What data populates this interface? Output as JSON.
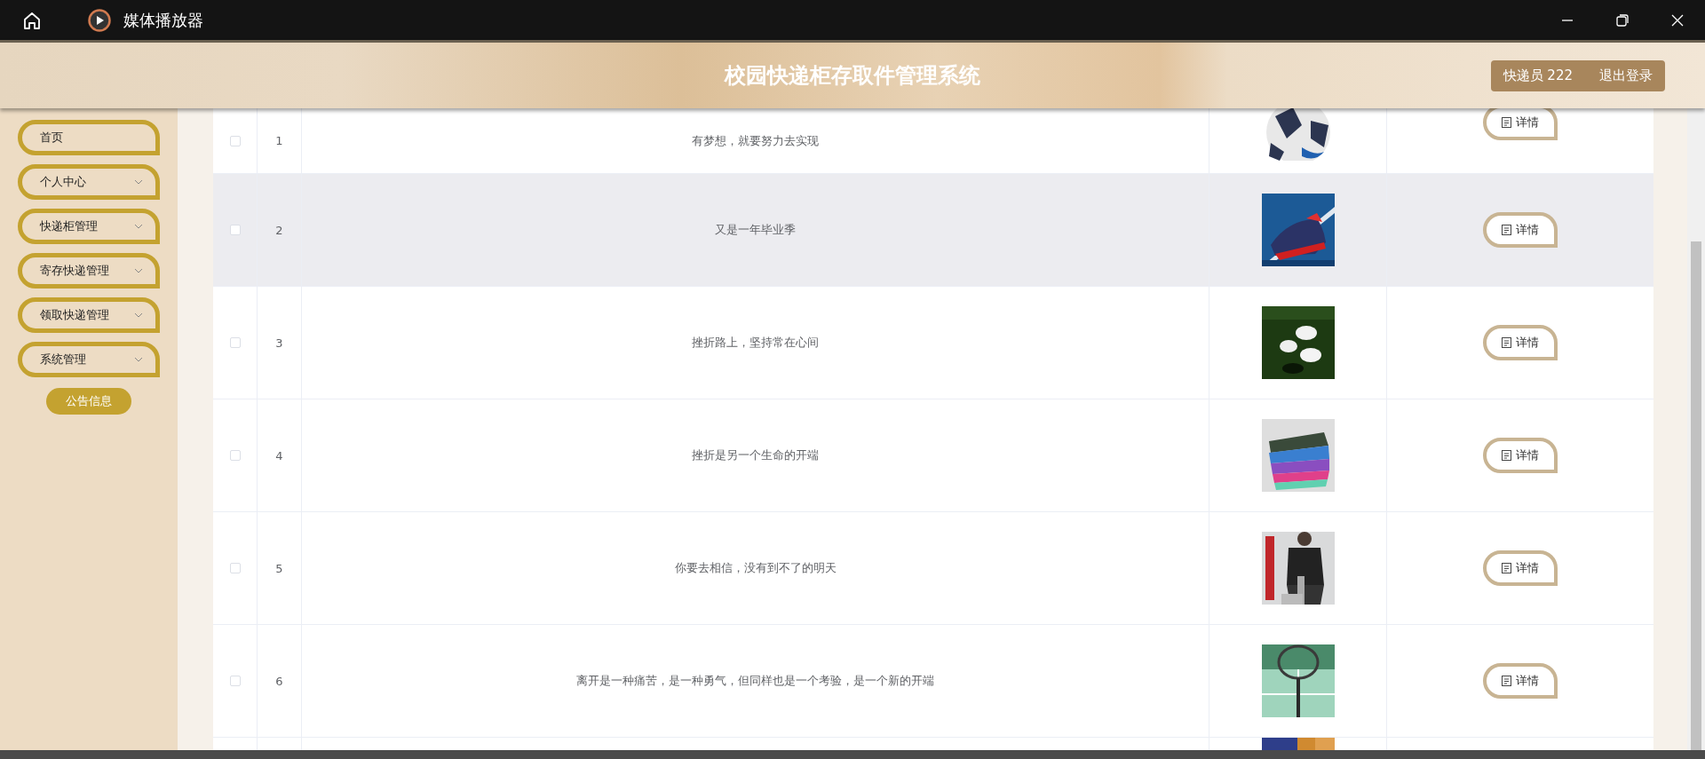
{
  "titlebar": {
    "app_name": "媒体播放器"
  },
  "header": {
    "title": "校园快递柜存取件管理系统",
    "user": "快递员 222",
    "logout": "退出登录"
  },
  "sidebar": {
    "items": [
      {
        "label": "首页",
        "kind": "link"
      },
      {
        "label": "个人中心",
        "kind": "menu"
      },
      {
        "label": "快递柜管理",
        "kind": "menu"
      },
      {
        "label": "寄存快递管理",
        "kind": "menu"
      },
      {
        "label": "领取快递管理",
        "kind": "menu"
      },
      {
        "label": "系统管理",
        "kind": "menu"
      }
    ],
    "notice_button": "公告信息"
  },
  "table": {
    "rows": [
      {
        "kind": "full",
        "checked": false,
        "hovered": false,
        "index": "1",
        "title": "有梦想，就要努力去实现",
        "action": "详情"
      },
      {
        "kind": "full",
        "checked": false,
        "hovered": true,
        "index": "2",
        "title": "又是一年毕业季",
        "action": "详情"
      },
      {
        "kind": "full",
        "checked": false,
        "hovered": false,
        "index": "3",
        "title": "挫折路上，坚持常在心间",
        "action": "详情"
      },
      {
        "kind": "full",
        "checked": false,
        "hovered": false,
        "index": "4",
        "title": "挫折是另一个生命的开端",
        "action": "详情"
      },
      {
        "kind": "full",
        "checked": false,
        "hovered": false,
        "index": "5",
        "title": "你要去相信，没有到不了的明天",
        "action": "详情"
      },
      {
        "kind": "full",
        "checked": false,
        "hovered": false,
        "index": "6",
        "title": "离开是一种痛苦，是一种勇气，但同样也是一个考验，是一个新的开端",
        "action": "详情"
      },
      {
        "kind": "partial"
      }
    ]
  }
}
